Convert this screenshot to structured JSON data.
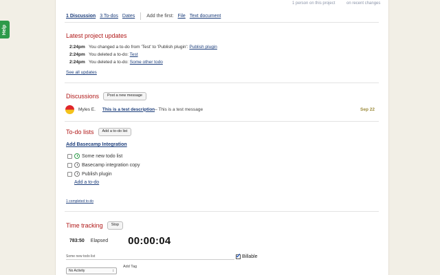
{
  "help": {
    "label": "Help"
  },
  "top_notes": {
    "people": "1 person on this project",
    "changes": "on recent changes"
  },
  "tabs": {
    "discussion": "1 Discussion",
    "todos": "3 To-dos",
    "dates": "Dates",
    "add_first_label": "Add the first:",
    "file": "File",
    "text_document": "Text document"
  },
  "updates": {
    "heading": "Latest project updates",
    "items": [
      {
        "time": "2:24pm",
        "text": "You changed a to-do from 'Test' to 'Publish plugin':",
        "link": "Publish plugin"
      },
      {
        "time": "2:24pm",
        "text": "You deleted a to-do:",
        "link": "Test"
      },
      {
        "time": "2:24pm",
        "text": "You deleted a to-do:",
        "link": "Some other todo"
      }
    ],
    "see_all": "See all updates"
  },
  "discussions": {
    "heading": "Discussions",
    "post_button": "Post a new message",
    "item": {
      "author": "Myles E.",
      "title": "This is a test description",
      "excerpt": " – This is a test message",
      "date": "Sep 22"
    }
  },
  "todo_lists": {
    "heading": "To-do lists",
    "add_button": "Add a to-do list",
    "list_title": "Add Basecamp Integration",
    "items": [
      {
        "label": "Some new todo list",
        "clock": "green"
      },
      {
        "label": "Basecamp integration copy",
        "clock": "grey"
      },
      {
        "label": "Publish plugin",
        "clock": "grey"
      }
    ],
    "add_todo": "Add a to-do",
    "completed": "1 completed to-do"
  },
  "time_tracking": {
    "heading": "Time tracking",
    "stop_button": "Stop",
    "hours": "783:50",
    "elapsed_label": "Elapsed",
    "timer": "00:00:04",
    "description_value": "Some new todo list",
    "billable_label": "Billable",
    "billable_checked": true,
    "activity_selected": "No Activity",
    "add_tag": "Add Tag"
  }
}
